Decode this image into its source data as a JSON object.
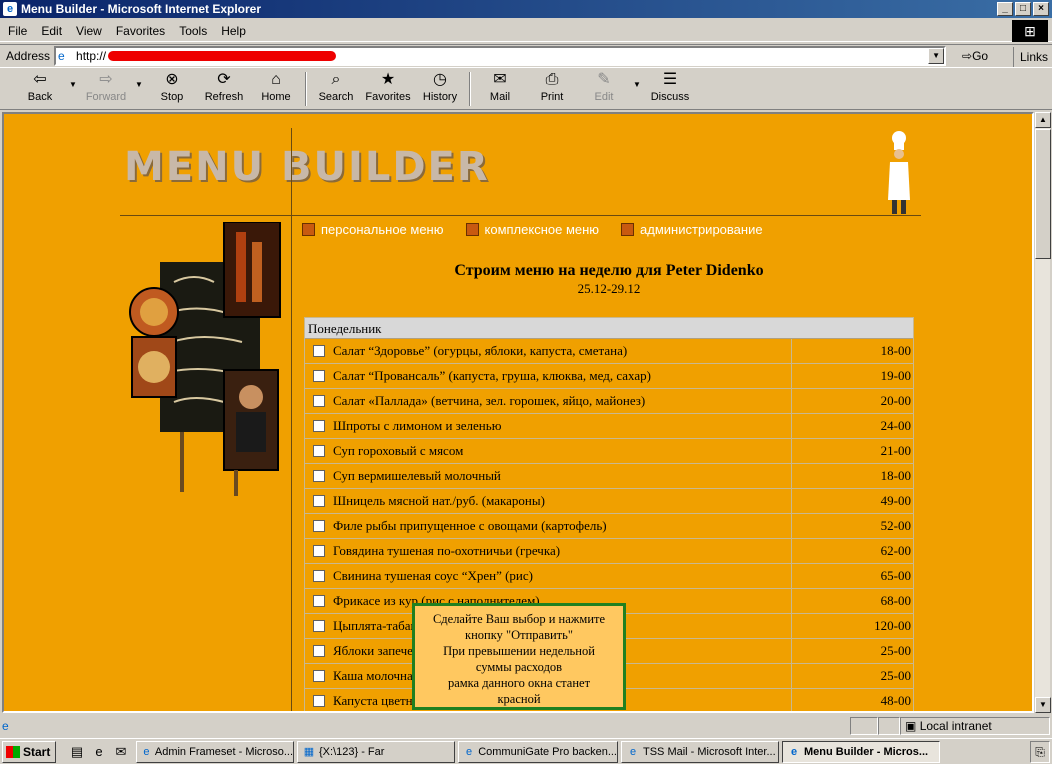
{
  "window": {
    "title": "Menu Builder - Microsoft Internet Explorer"
  },
  "menubar": [
    "File",
    "Edit",
    "View",
    "Favorites",
    "Tools",
    "Help"
  ],
  "address": {
    "label": "Address",
    "url": "http://",
    "go": "Go",
    "links": "Links"
  },
  "toolbar": {
    "back": "Back",
    "forward": "Forward",
    "stop": "Stop",
    "refresh": "Refresh",
    "home": "Home",
    "search": "Search",
    "favorites": "Favorites",
    "history": "History",
    "mail": "Mail",
    "print": "Print",
    "edit": "Edit",
    "discuss": "Discuss"
  },
  "page": {
    "brand": "MENU BUILDER",
    "nav": [
      "персональное меню",
      "комплексное меню",
      "администрирование"
    ],
    "heading": "Строим меню на неделю для Peter Didenko",
    "dates": "25.12-29.12",
    "day": "Понедельник",
    "items": [
      {
        "name": "Салат “Здоровье” (огурцы, яблоки, капуста, сметана)",
        "price": "18-00"
      },
      {
        "name": "Салат “Провансаль” (капуста, груша, клюква, мед, сахар)",
        "price": "19-00"
      },
      {
        "name": "Салат «Паллада» (ветчина, зел. горошек, яйцо, майонез)",
        "price": "20-00"
      },
      {
        "name": "Шпроты с лимоном и зеленью",
        "price": "24-00"
      },
      {
        "name": "Суп гороховый с мясом",
        "price": "21-00"
      },
      {
        "name": "Суп вермишелевый молочный",
        "price": "18-00"
      },
      {
        "name": "Шницель мясной нат./руб. (макароны)",
        "price": "49-00"
      },
      {
        "name": "Филе рыбы припущенное с овощами (картофель)",
        "price": "52-00"
      },
      {
        "name": "Говядина тушеная по-охотничьи (гречка)",
        "price": "62-00"
      },
      {
        "name": "Свинина тушеная соус “Хрен” (рис)",
        "price": "65-00"
      },
      {
        "name": "Фрикасе из кур (рис с наполнителем)",
        "price": "68-00"
      },
      {
        "name": "Цыплята-табака",
        "price": "120-00"
      },
      {
        "name": "Яблоки запеченные",
        "price": "25-00"
      },
      {
        "name": "Каша молочная",
        "price": "25-00"
      },
      {
        "name": "Капуста цветная",
        "price": "48-00"
      }
    ],
    "tooltip": [
      "Сделайте Ваш выбор и нажмите",
      "кнопку \"Отправить\"",
      "При превышении недельной",
      "суммы расходов",
      "рамка данного окна станет",
      "красной"
    ]
  },
  "status": {
    "zone": "Local intranet"
  },
  "taskbar": {
    "start": "Start",
    "tasks": [
      "Admin Frameset - Microso...",
      "{X:\\123} - Far",
      "CommuniGate Pro backen...",
      "TSS Mail - Microsoft Inter...",
      "Menu Builder - Micros..."
    ]
  }
}
